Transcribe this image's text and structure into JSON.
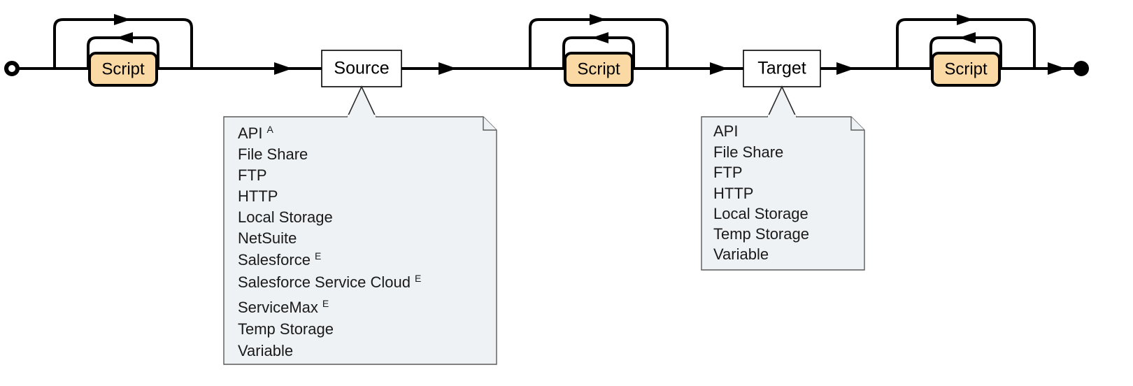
{
  "diagram": {
    "type": "railroad-syntax-diagram",
    "orientation": "horizontal",
    "start_terminal": "circle-hollow",
    "end_terminal": "circle-filled",
    "sequence": [
      {
        "id": "script-1",
        "label": "Script",
        "kind": "script",
        "optional": true,
        "repeatable": true
      },
      {
        "id": "source",
        "label": "Source",
        "kind": "step",
        "optional": false,
        "repeatable": false
      },
      {
        "id": "script-2",
        "label": "Script",
        "kind": "script",
        "optional": true,
        "repeatable": true
      },
      {
        "id": "target",
        "label": "Target",
        "kind": "step",
        "optional": false,
        "repeatable": false
      },
      {
        "id": "script-3",
        "label": "Script",
        "kind": "script",
        "optional": true,
        "repeatable": true
      }
    ],
    "colors": {
      "script_fill": "#fbd9a5",
      "step_fill": "#ffffff",
      "note_fill": "#eef2f5",
      "note_stroke": "#5a5a5a",
      "rail_stroke": "#000000"
    }
  },
  "nodes": {
    "script1": {
      "label": "Script"
    },
    "source": {
      "label": "Source"
    },
    "script2": {
      "label": "Script"
    },
    "target": {
      "label": "Target"
    },
    "script3": {
      "label": "Script"
    }
  },
  "notes": {
    "source_note": {
      "attached_to": "Source",
      "items": [
        {
          "text": "API",
          "sup": "A"
        },
        {
          "text": "File Share",
          "sup": ""
        },
        {
          "text": "FTP",
          "sup": ""
        },
        {
          "text": "HTTP",
          "sup": ""
        },
        {
          "text": "Local Storage",
          "sup": ""
        },
        {
          "text": "NetSuite",
          "sup": ""
        },
        {
          "text": "Salesforce",
          "sup": "E"
        },
        {
          "text": "Salesforce Service Cloud",
          "sup": "E"
        },
        {
          "text": "ServiceMax",
          "sup": "E"
        },
        {
          "text": "Temp Storage",
          "sup": ""
        },
        {
          "text": "Variable",
          "sup": ""
        }
      ]
    },
    "target_note": {
      "attached_to": "Target",
      "items": [
        {
          "text": "API",
          "sup": ""
        },
        {
          "text": "File Share",
          "sup": ""
        },
        {
          "text": "FTP",
          "sup": ""
        },
        {
          "text": "HTTP",
          "sup": ""
        },
        {
          "text": "Local Storage",
          "sup": ""
        },
        {
          "text": "Temp Storage",
          "sup": ""
        },
        {
          "text": "Variable",
          "sup": ""
        }
      ]
    }
  }
}
